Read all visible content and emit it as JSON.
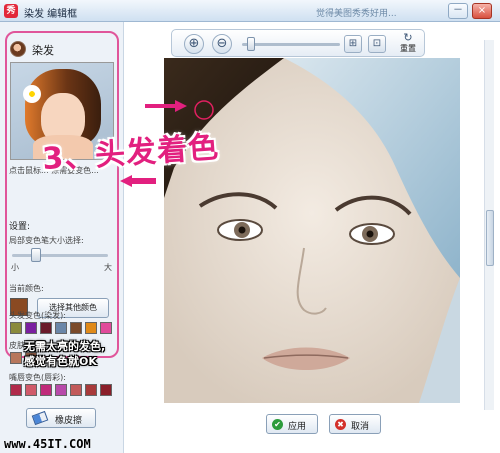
{
  "window": {
    "app_icon": "秀",
    "title": "染发 编辑框",
    "hint": "觉得美图秀秀好用...",
    "minimize": "－",
    "close": "×"
  },
  "panel": {
    "title": "染发",
    "description": "点击鼠标... 涂需要变色...",
    "settings_label": "设置:",
    "brush_label": "局部变色笔大小选择:",
    "slider_min": "小",
    "slider_max": "大",
    "brush_size_level": 0.22,
    "current_color_label": "当前颜色:",
    "current_color": "#8a4a22",
    "pick_other_color": "选择其他颜色",
    "hair_colors_label": "头发变色(染发):",
    "hair_colors": [
      "#8a8a3c",
      "#7a1fa0",
      "#6a1a2a",
      "#6a86a8",
      "#7a4a2a",
      "#e08a1a",
      "#e04a9a"
    ],
    "skin_colors_label": "皮肤变色",
    "skin_colors": [
      "#b7775c",
      "#8d5a44"
    ],
    "lip_colors_label": "嘴唇变色(唇彩):",
    "lip_colors": [
      "#b02a4a",
      "#d05a6a",
      "#c02a7a",
      "#b84aaa",
      "#c25a5a",
      "#a83a3a",
      "#8a1f2a"
    ],
    "eraser_label": "橡皮擦"
  },
  "toolbar": {
    "zoom_in_icon": "⊕",
    "zoom_out_icon": "⊖",
    "zoom_level": 0.05,
    "fit_icon": "⊞",
    "actual_size_icon": "⊡",
    "reset_label": "重置",
    "reset_icon": "↻"
  },
  "annotations": {
    "step_note": "3、头发着色",
    "tip_line1": "无需太亮的发色,",
    "tip_line2": "感觉有色就OK",
    "watermark": "www.45IT.COM",
    "arrow_color": "#e2207f"
  },
  "actions": {
    "apply_label": "应用",
    "apply_icon": "✔",
    "cancel_label": "取消",
    "cancel_icon": "✖"
  }
}
